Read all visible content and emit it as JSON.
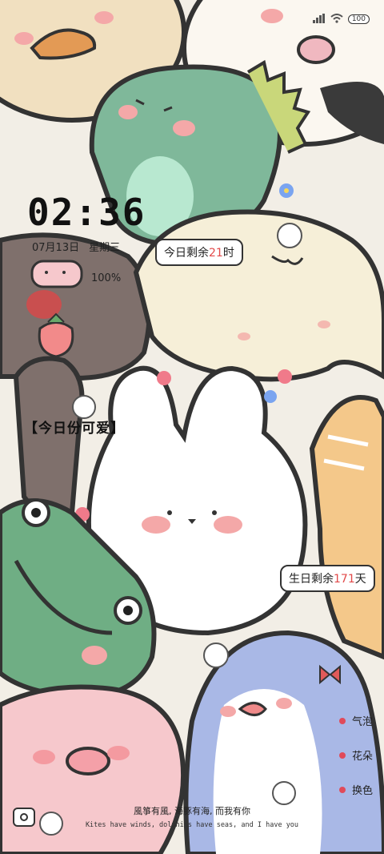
{
  "status_bar": {
    "battery": "100"
  },
  "clock": {
    "time": "02:36",
    "date": "07月13日",
    "weekday": "星期三",
    "battery_percent": "100%"
  },
  "widgets": {
    "today_remaining": {
      "prefix": "今日剩余",
      "value": "21",
      "suffix": "时"
    },
    "birthday_remaining": {
      "prefix": "生日剩余",
      "value": "171",
      "suffix": "天"
    },
    "daily_cute": "【今日份可爱】"
  },
  "side_menu": {
    "items": [
      {
        "label": "气泡"
      },
      {
        "label": "花朵"
      },
      {
        "label": "换色"
      }
    ]
  },
  "footer": {
    "chinese": "風箏有風, 海豚有海, 而我有你",
    "english": "Kites have winds, dolphins have seas, and I have you"
  },
  "colors": {
    "accent": "#e24a4a",
    "outline": "#333333",
    "dino": "#7fb89a",
    "bunny": "#ffffff",
    "frog": "#6fae84",
    "pig": "#f6c8cc",
    "penguin": "#a9b8e6"
  }
}
